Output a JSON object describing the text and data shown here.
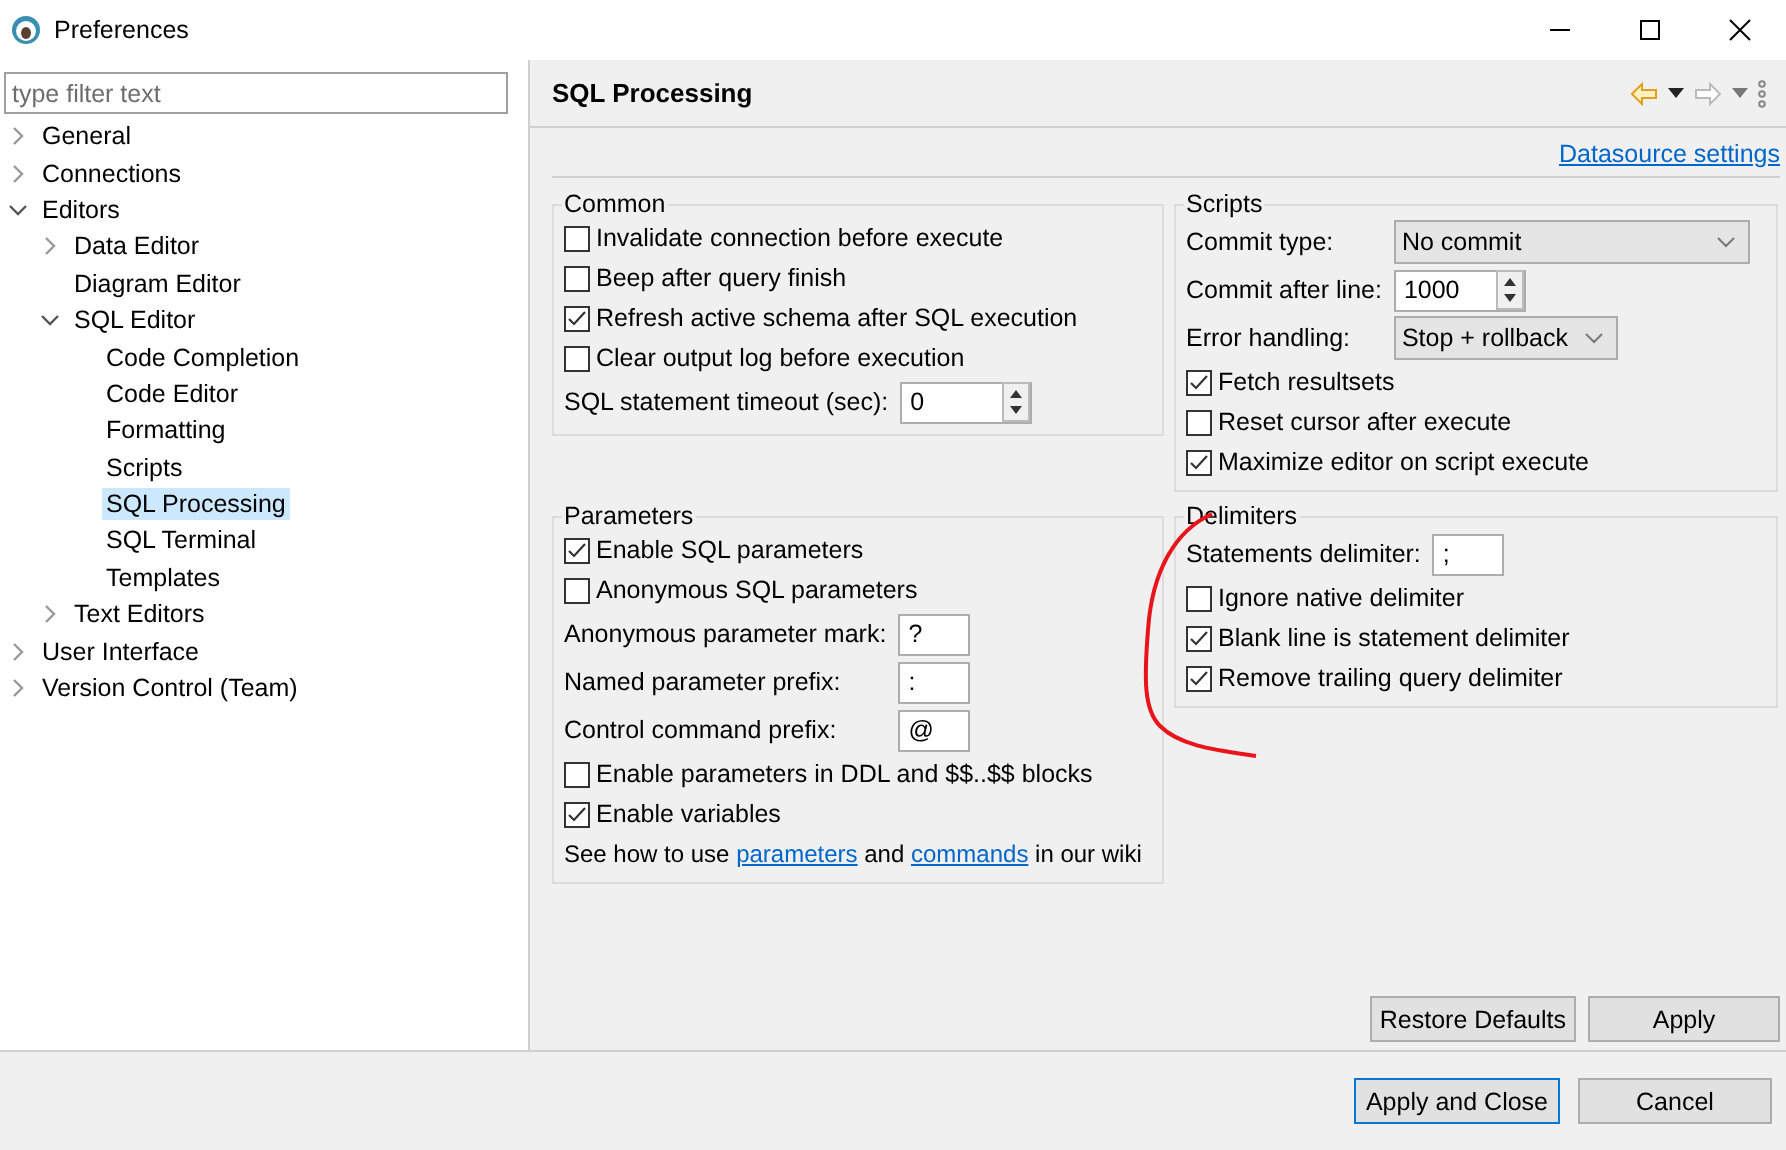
{
  "window": {
    "title": "Preferences"
  },
  "filter": {
    "placeholder": "type filter text"
  },
  "tree": [
    {
      "label": "General",
      "expanded": false,
      "selected": false
    },
    {
      "label": "Connections",
      "expanded": false,
      "selected": false
    },
    {
      "label": "Editors",
      "expanded": true,
      "selected": false,
      "children": [
        {
          "label": "Data Editor",
          "expanded": false,
          "selected": false
        },
        {
          "label": "Diagram Editor",
          "selected": false
        },
        {
          "label": "SQL Editor",
          "expanded": true,
          "selected": false,
          "children": [
            {
              "label": "Code Completion",
              "selected": false
            },
            {
              "label": "Code Editor",
              "selected": false
            },
            {
              "label": "Formatting",
              "selected": false
            },
            {
              "label": "Scripts",
              "selected": false
            },
            {
              "label": "SQL Processing",
              "selected": true
            },
            {
              "label": "SQL Terminal",
              "selected": false
            },
            {
              "label": "Templates",
              "selected": false
            }
          ]
        },
        {
          "label": "Text Editors",
          "expanded": false,
          "selected": false
        }
      ]
    },
    {
      "label": "User Interface",
      "expanded": false,
      "selected": false
    },
    {
      "label": "Version Control (Team)",
      "expanded": false,
      "selected": false
    }
  ],
  "page": {
    "title": "SQL Processing",
    "link": "Datasource settings"
  },
  "groups": [
    {
      "title": "Common",
      "items": [
        {
          "kind": "checkbox",
          "label": "Invalidate connection before execute",
          "checked": false
        },
        {
          "kind": "checkbox",
          "label": "Beep after query finish",
          "checked": false
        },
        {
          "kind": "checkbox",
          "label": "Refresh active schema after SQL execution",
          "checked": true
        },
        {
          "kind": "checkbox",
          "label": "Clear output log before execution",
          "checked": false
        },
        {
          "kind": "spinner",
          "label": "SQL statement timeout (sec):",
          "value": "0"
        }
      ]
    },
    {
      "title": "Scripts",
      "items": [
        {
          "kind": "dropdown",
          "label": "Commit type:",
          "value": "No commit"
        },
        {
          "kind": "spinner",
          "label": "Commit after line:",
          "value": "1000"
        },
        {
          "kind": "dropdown",
          "label": "Error handling:",
          "value": "Stop + rollback"
        },
        {
          "kind": "checkbox",
          "label": "Fetch resultsets",
          "checked": true
        },
        {
          "kind": "checkbox",
          "label": "Reset cursor after execute",
          "checked": false
        },
        {
          "kind": "checkbox",
          "label": "Maximize editor on script execute",
          "checked": true
        }
      ]
    },
    {
      "title": "Parameters",
      "items": [
        {
          "kind": "checkbox",
          "label": "Enable SQL parameters",
          "checked": true
        },
        {
          "kind": "checkbox",
          "label": "Anonymous SQL parameters",
          "checked": false
        },
        {
          "kind": "text",
          "label": "Anonymous parameter mark:",
          "value": "?"
        },
        {
          "kind": "text",
          "label": "Named parameter prefix:",
          "value": ":"
        },
        {
          "kind": "text",
          "label": "Control command prefix:",
          "value": "@"
        },
        {
          "kind": "checkbox",
          "label": "Enable parameters in DDL and $$..$$ blocks",
          "checked": false
        },
        {
          "kind": "checkbox",
          "label": "Enable variables",
          "checked": true
        },
        {
          "kind": "note",
          "parts": [
            {
              "kind": "text",
              "text": "See how to use"
            },
            {
              "kind": "link",
              "text": "parameters"
            },
            {
              "kind": "text",
              "text": "and"
            },
            {
              "kind": "link",
              "text": "commands"
            },
            {
              "kind": "text",
              "text": "in our wiki"
            }
          ]
        }
      ]
    },
    {
      "title": "Delimiters",
      "items": [
        {
          "kind": "text",
          "label": "Statements delimiter:",
          "value": ";"
        },
        {
          "kind": "checkbox",
          "label": "Ignore native delimiter",
          "checked": false
        },
        {
          "kind": "checkbox",
          "label": "Blank line is statement delimiter",
          "checked": true
        },
        {
          "kind": "checkbox",
          "label": "Remove trailing query delimiter",
          "checked": true
        }
      ]
    }
  ],
  "page_buttons": [
    "Restore Defaults",
    "Apply"
  ],
  "dialog_buttons": [
    {
      "label": "Apply and Close",
      "default": true
    },
    {
      "label": "Cancel",
      "default": false
    }
  ]
}
